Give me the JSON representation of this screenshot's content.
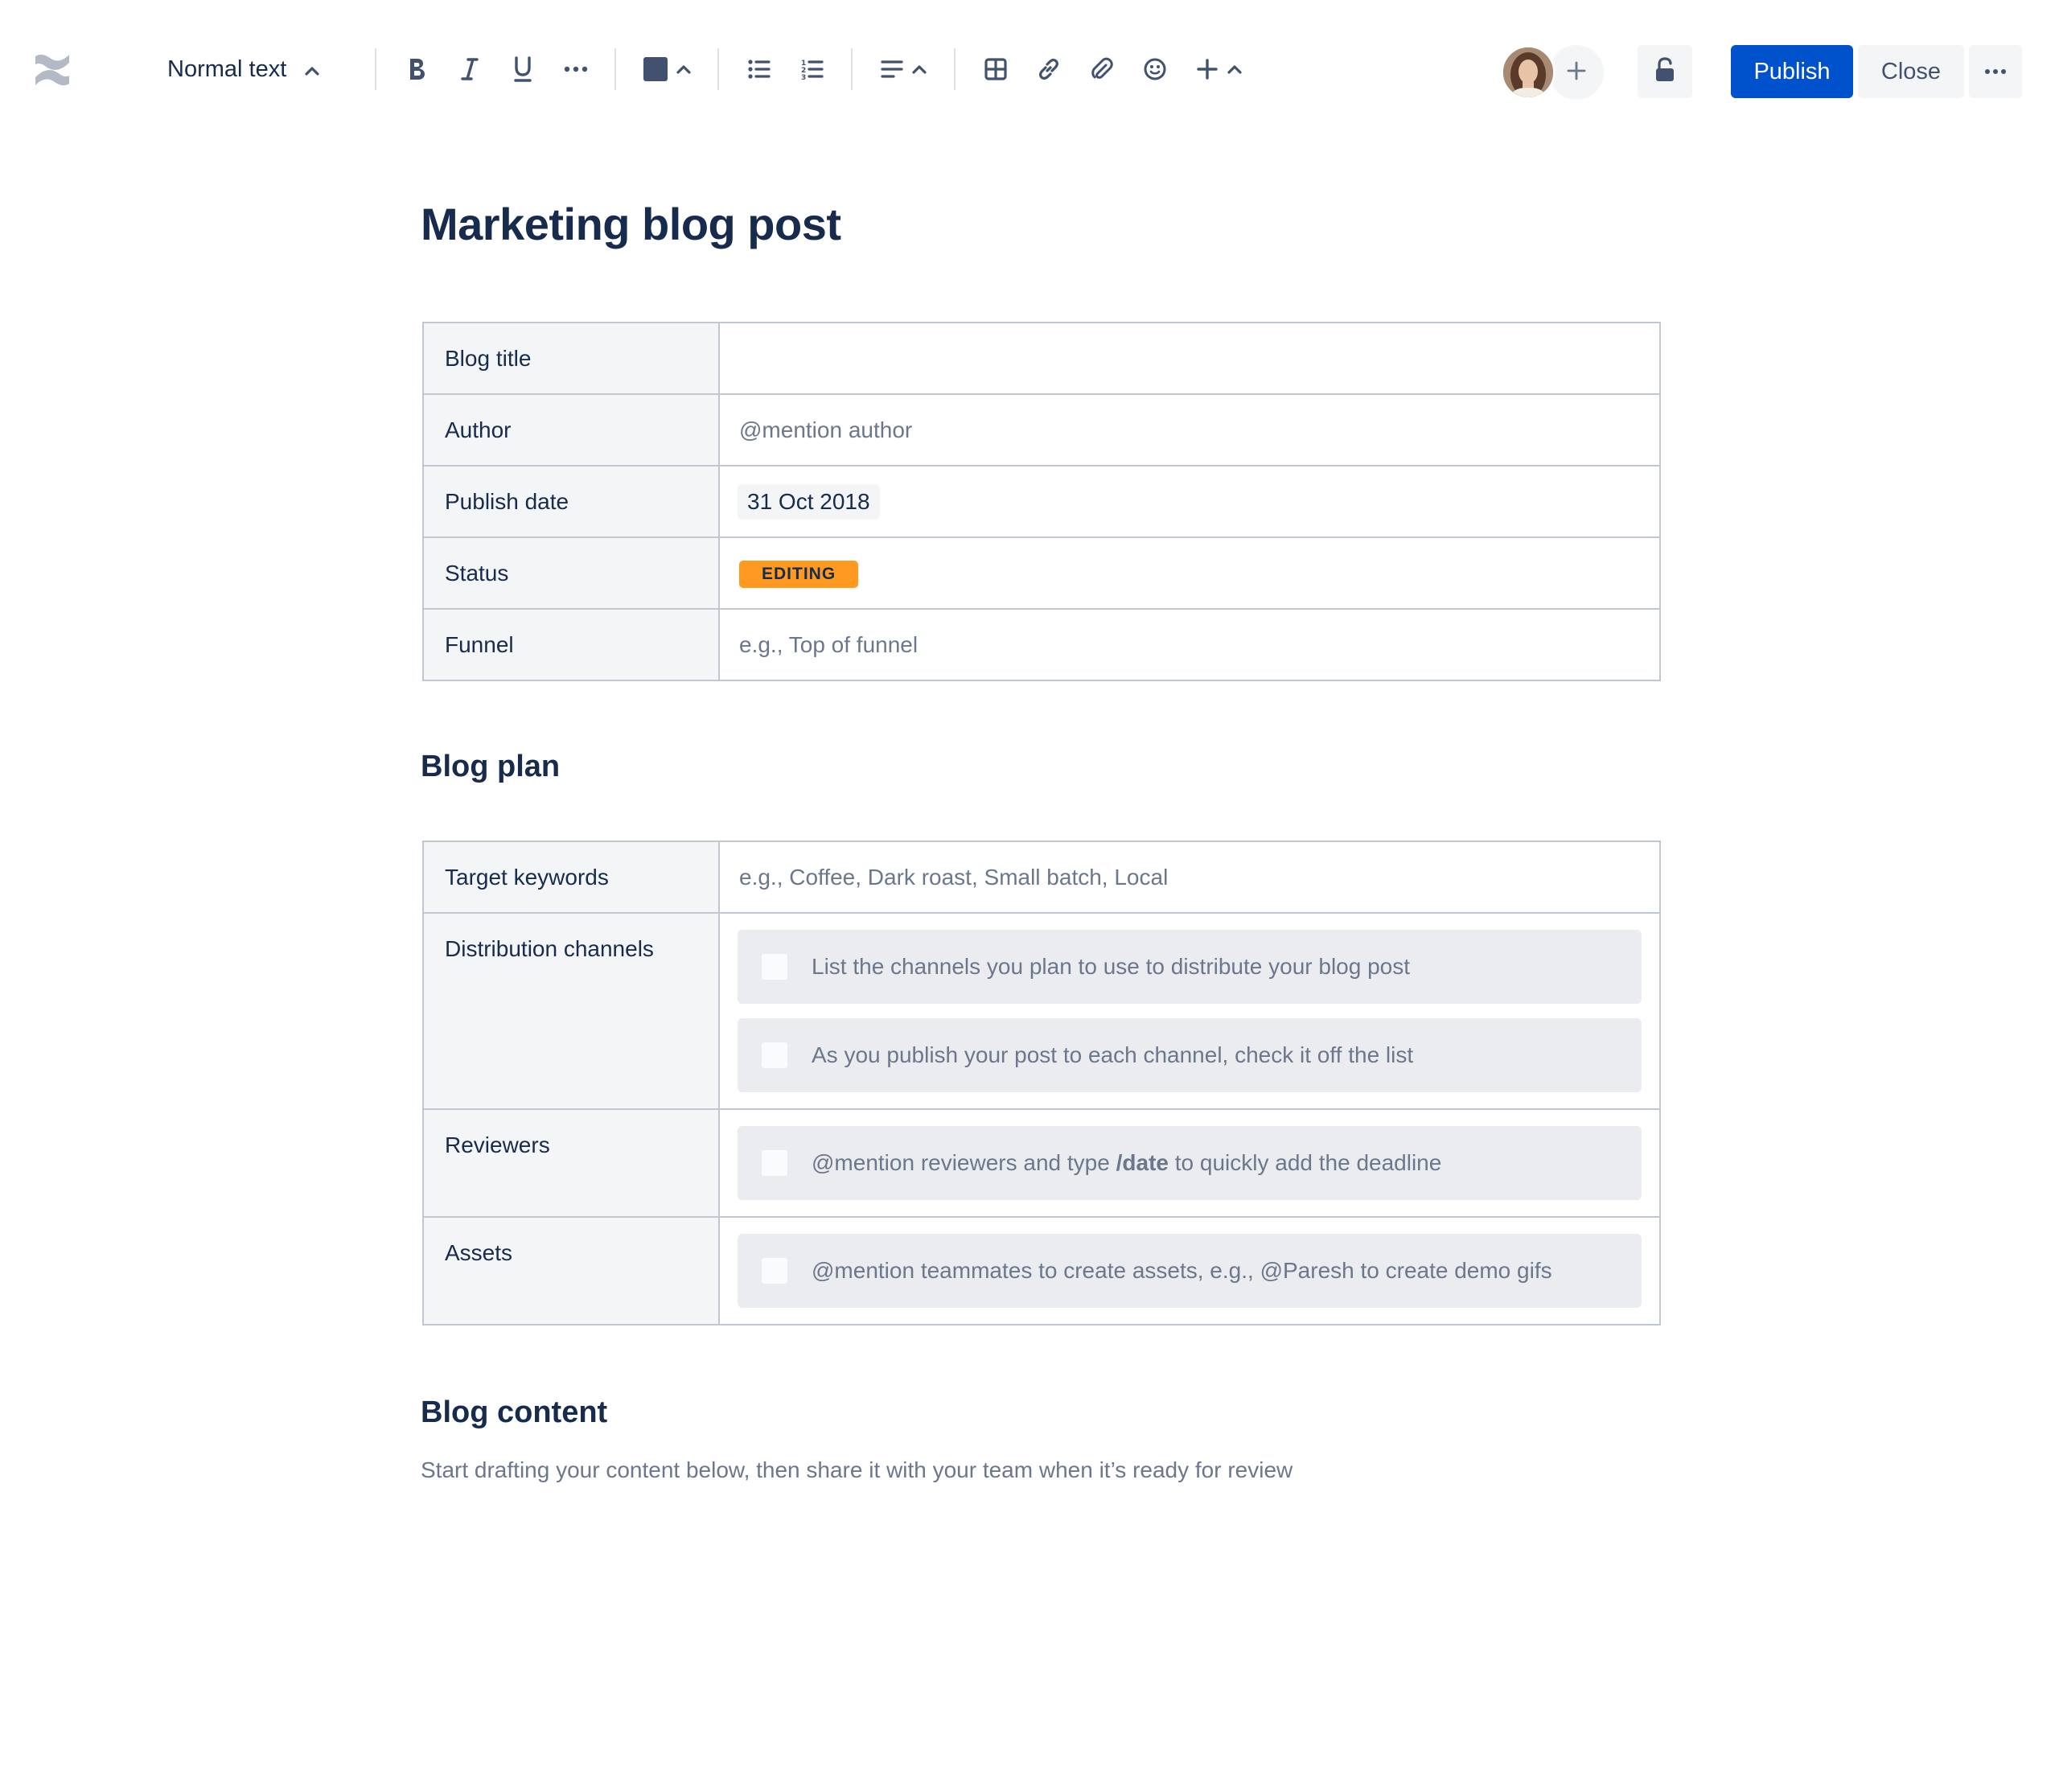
{
  "toolbar": {
    "text_style": "Normal text",
    "actions": {
      "publish": "Publish",
      "close": "Close"
    }
  },
  "page": {
    "title": "Marketing blog post"
  },
  "details_table": [
    {
      "label": "Blog title",
      "value": ""
    },
    {
      "label": "Author",
      "placeholder": "@mention author"
    },
    {
      "label": "Publish date",
      "date": "31 Oct 2018"
    },
    {
      "label": "Status",
      "status": "EDITING"
    },
    {
      "label": "Funnel",
      "placeholder": "e.g., Top of funnel"
    }
  ],
  "blog_plan": {
    "heading": "Blog plan",
    "rows": [
      {
        "label": "Target keywords",
        "placeholder": "e.g., Coffee, Dark roast, Small batch, Local"
      },
      {
        "label": "Distribution channels",
        "tasks": [
          "List the channels you plan to use to distribute your blog post",
          "As you publish your post to each channel, check it off the list"
        ]
      },
      {
        "label": "Reviewers",
        "task_prefix": "@mention reviewers and type ",
        "task_bold": "/date",
        "task_suffix": " to quickly add the deadline"
      },
      {
        "label": "Assets",
        "task": "@mention teammates to create assets, e.g., @Paresh to create demo gifs"
      }
    ]
  },
  "blog_content": {
    "heading": "Blog content",
    "placeholder": "Start drafting your content below, then share it with your team when it’s ready for review"
  },
  "colors": {
    "primary": "#0052cc",
    "status_editing": "#ff991f",
    "text": "#172b4d",
    "subtle_text": "#6b778c"
  }
}
